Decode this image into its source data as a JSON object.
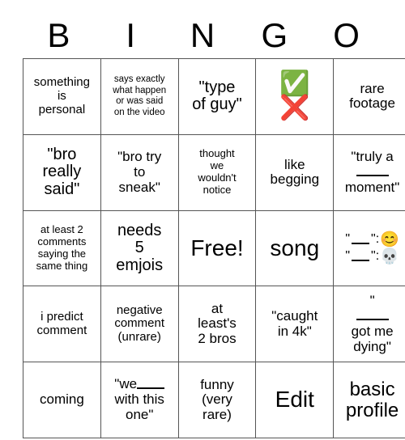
{
  "card": {
    "title": "BINGO",
    "header_letters": [
      "B",
      "I",
      "N",
      "G",
      "O"
    ],
    "rows": [
      [
        {
          "text": "something\nis\npersonal",
          "size": "fs-s"
        },
        {
          "text": "says exactly\nwhat happen\nor was said\non the video",
          "size": "fs-xxs"
        },
        {
          "text": "\"type\nof guy\"",
          "size": "fs-l"
        },
        {
          "type": "emoji-stack",
          "emojis": [
            "✅",
            "❌"
          ],
          "names": [
            "check-mark-emoji",
            "cross-mark-emoji"
          ]
        },
        {
          "text": "rare\nfootage",
          "size": "fs-m"
        }
      ],
      [
        {
          "text": "\"bro\nreally\nsaid\"",
          "size": "fs-l"
        },
        {
          "text": "\"bro try\nto\nsneak\"",
          "size": "fs-m"
        },
        {
          "text": "thought\nwe\nwouldn't\nnotice",
          "size": "fs-xs"
        },
        {
          "text": "like\nbegging",
          "size": "fs-m"
        },
        {
          "type": "blank-phrase",
          "before": "\"truly a",
          "after": "moment\"",
          "size": "fs-m"
        }
      ],
      [
        {
          "text": "at least 2\ncomments\nsaying the\nsame thing",
          "size": "fs-xs"
        },
        {
          "text": "needs\n5\nemjois",
          "size": "fs-l"
        },
        {
          "text": "Free!",
          "size": "fs-xxl"
        },
        {
          "text": "song",
          "size": "fs-xxl"
        },
        {
          "type": "quote-emoji",
          "lines": [
            {
              "quote_open": "\"",
              "quote_close": "\"",
              "punct": ":",
              "emoji": "😊",
              "name": "smiling-face-emoji"
            },
            {
              "quote_open": "\"",
              "quote_close": "\"",
              "punct": ":",
              "emoji": "💀",
              "name": "skull-emoji"
            }
          ]
        }
      ],
      [
        {
          "text": "i predict\ncomment",
          "size": "fs-s"
        },
        {
          "text": "negative\ncomment\n(unrare)",
          "size": "fs-s"
        },
        {
          "text": "at\nleast's\n2 bros",
          "size": "fs-m"
        },
        {
          "text": "\"caught\nin 4k\"",
          "size": "fs-m"
        },
        {
          "type": "blank-phrase",
          "before": "\"",
          "after": "got me\ndying\"",
          "size": "fs-m"
        }
      ],
      [
        {
          "text": "coming",
          "size": "fs-m"
        },
        {
          "type": "inline-blank",
          "before": "\"we",
          "after": "with this\none\"",
          "size": "fs-m"
        },
        {
          "text": "funny\n(very\nrare)",
          "size": "fs-m"
        },
        {
          "text": "Edit",
          "size": "fs-xxl"
        },
        {
          "text": "basic\nprofile",
          "size": "fs-xl"
        }
      ]
    ]
  },
  "colors": {
    "grid_line": "#555555",
    "background": "#ffffff",
    "text": "#000000",
    "check_green": "#6FA84F",
    "cross_red": "#E5403A"
  }
}
